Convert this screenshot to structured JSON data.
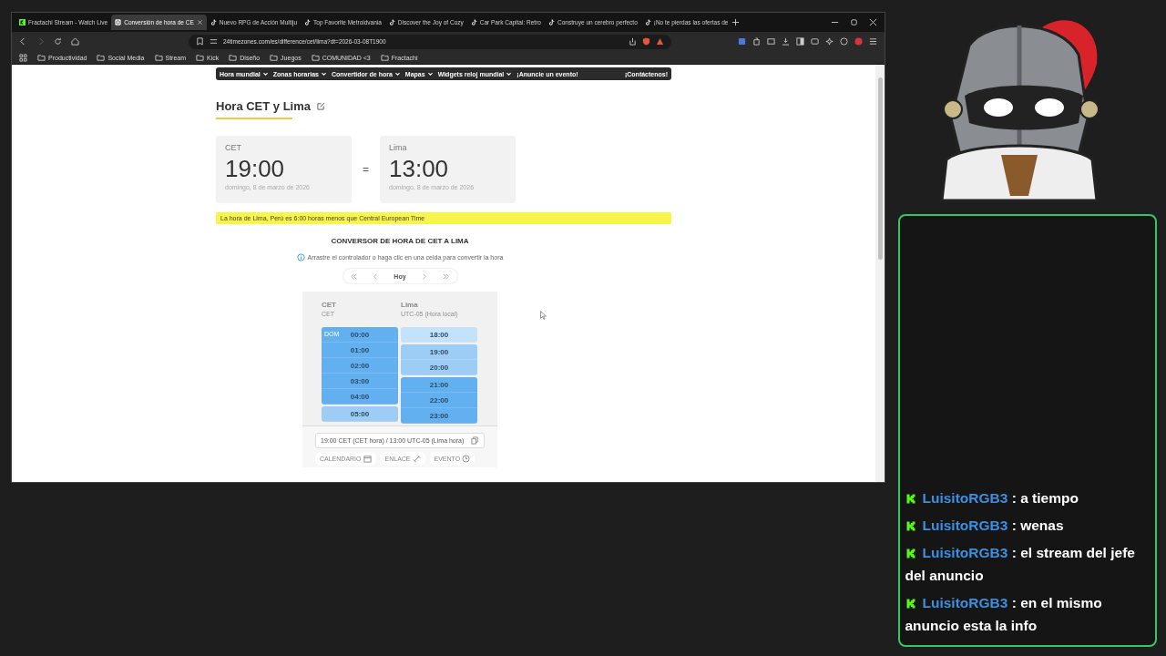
{
  "browser": {
    "tabs": [
      {
        "title": "Fractachi Stream - Watch Live",
        "kind": "kick",
        "selected": false
      },
      {
        "title": "Conversión de hora de CE",
        "kind": "site",
        "selected": true
      },
      {
        "title": "Nuevo RPG de Acción Multiju",
        "kind": "tiktok",
        "selected": false
      },
      {
        "title": "Top Favorite Metroidvania",
        "kind": "tiktok",
        "selected": false
      },
      {
        "title": "Discover the Joy of Cozy",
        "kind": "tiktok",
        "selected": false
      },
      {
        "title": "Car Park Capital: Retro",
        "kind": "tiktok",
        "selected": false
      },
      {
        "title": "Construye un cerebro perfecto",
        "kind": "tiktok",
        "selected": false
      },
      {
        "title": "¡No te pierdas las ofertas de",
        "kind": "tiktok",
        "selected": false
      }
    ],
    "address": "24timezones.com/es/difference/cet/lima?dt=2026-03-08T1900",
    "bookmarks": [
      "Productividad",
      "Social Media",
      "Stream",
      "Kick",
      "Diseño",
      "Juegos",
      "COMUNIDAD <3",
      "Fractachi"
    ]
  },
  "page": {
    "nav": [
      {
        "label": "Hora mundial",
        "dropdown": true
      },
      {
        "label": "Zonas horarias",
        "dropdown": true
      },
      {
        "label": "Convertidor de hora",
        "dropdown": true
      },
      {
        "label": "Mapas",
        "dropdown": true
      },
      {
        "label": "Widgets reloj mundial",
        "dropdown": true
      },
      {
        "label": "¡Anuncie un evento!",
        "dropdown": false
      }
    ],
    "contact": "¡Contáctenos!",
    "heading": "Hora CET y Lima",
    "clocks": [
      {
        "zone": "CET",
        "time": "19:00",
        "date": "domingo, 8 de marzo de 2026"
      },
      {
        "zone": "Lima",
        "time": "13:00",
        "date": "domingo, 8 de marzo de 2026"
      }
    ],
    "equals": "=",
    "notice": "La hora de Lima, Perú es 6:00 horas menos que Central European Time",
    "converter": {
      "title": "CONVERSOR DE HORA DE CET A LIMA",
      "hint": "Arrastre el controlador o haga clic en una celda para convertir la hora",
      "today": "Hoy",
      "columns": [
        {
          "zone": "CET",
          "sub": "CET",
          "groups": [
            {
              "kind": "dark",
              "cells": [
                {
                  "time": "00:00",
                  "day": "DOM"
                },
                {
                  "time": "01:00"
                },
                {
                  "time": "02:00"
                },
                {
                  "time": "03:00"
                },
                {
                  "time": "04:00"
                }
              ]
            },
            {
              "kind": "medium",
              "cells": [
                {
                  "time": "05:00"
                }
              ]
            }
          ]
        },
        {
          "zone": "Lima",
          "sub": "UTC-05 (Hora local)",
          "groups": [
            {
              "kind": "light",
              "cells": [
                {
                  "time": "18:00"
                }
              ]
            },
            {
              "kind": "medium",
              "cells": [
                {
                  "time": "19:00"
                },
                {
                  "time": "20:00"
                }
              ]
            },
            {
              "kind": "dark",
              "cells": [
                {
                  "time": "21:00"
                },
                {
                  "time": "22:00"
                },
                {
                  "time": "23:00"
                }
              ]
            }
          ]
        }
      ],
      "summary": "19:00 CET (CET hora) / 13:00 UTC-05 (Lima hora)",
      "actions": [
        "CALENDARIO",
        "ENLACE",
        "EVENTO"
      ]
    }
  },
  "chat": {
    "messages": [
      {
        "user": "LuisitoRGB3",
        "text": ": a tiempo"
      },
      {
        "user": "LuisitoRGB3",
        "text": ": wenas"
      },
      {
        "user": "LuisitoRGB3",
        "text": ": el stream del jefe del anuncio"
      },
      {
        "user": "LuisitoRGB3",
        "text": ": en el mismo anuncio esta la info"
      }
    ]
  }
}
